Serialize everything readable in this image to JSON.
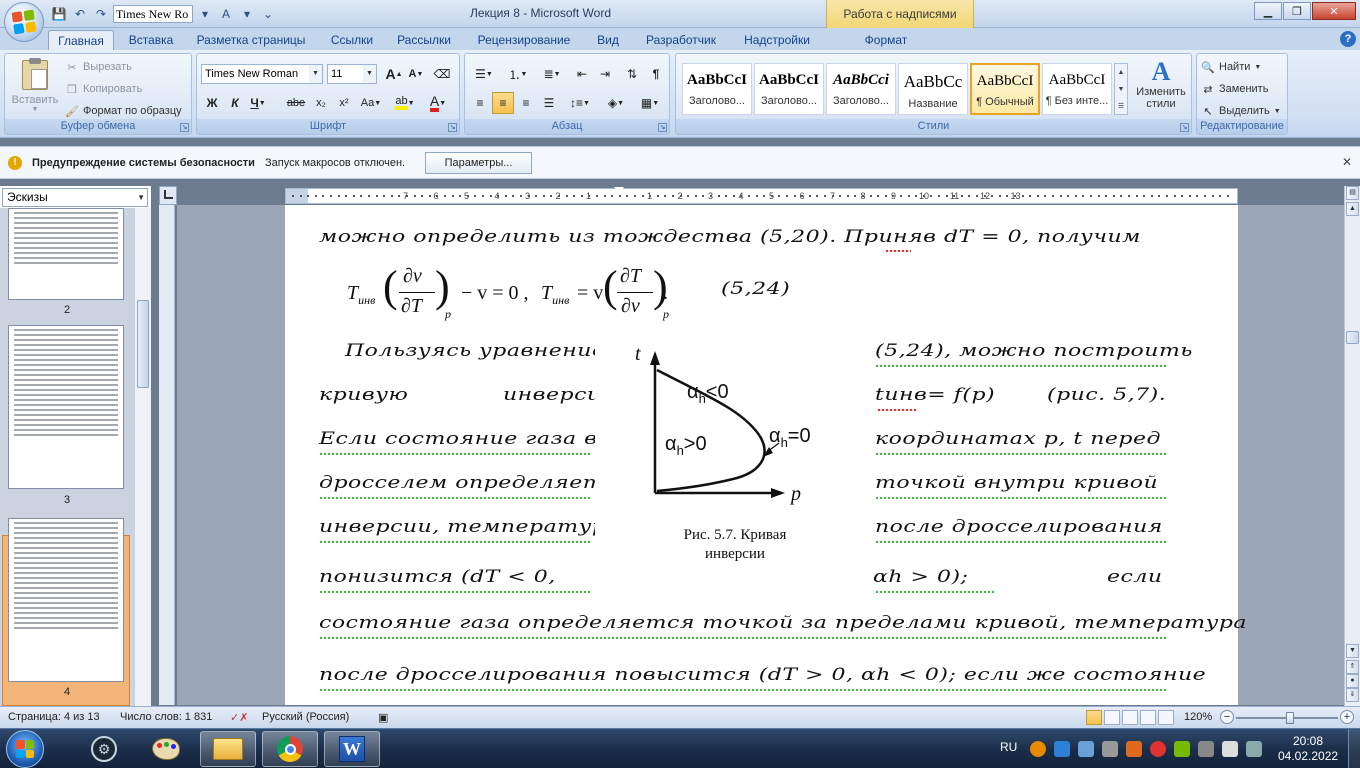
{
  "app": {
    "window_title": "Лекция 8 - Microsoft Word",
    "context_tab_title": "Работа с надписями",
    "qat_font": "Times New Ro",
    "help": "?"
  },
  "tabs": [
    "Главная",
    "Вставка",
    "Разметка страницы",
    "Ссылки",
    "Рассылки",
    "Рецензирование",
    "Вид",
    "Разработчик",
    "Надстройки",
    "Формат"
  ],
  "ribbon": {
    "clipboard": {
      "label": "Буфер обмена",
      "paste": "Вставить",
      "cut": "Вырезать",
      "copy": "Копировать",
      "format_painter": "Формат по образцу"
    },
    "font": {
      "label": "Шрифт",
      "font_name": "Times New Roman",
      "font_size": "11",
      "bold": "Ж",
      "italic": "К",
      "underline": "Ч",
      "strike": "abe",
      "subscript": "x₂",
      "superscript": "x²",
      "change_case": "Aa",
      "grow": "A",
      "shrink": "A"
    },
    "paragraph": {
      "label": "Абзац"
    },
    "styles": {
      "label": "Стили",
      "items": [
        {
          "sample": "AaBbCcI",
          "name": "Заголово..."
        },
        {
          "sample": "AaBbCcI",
          "name": "Заголово..."
        },
        {
          "sample": "AaBbCci",
          "name": "Заголово..."
        },
        {
          "sample": "AaBbCc",
          "name": "Название"
        },
        {
          "sample": "AaBbCcI",
          "name": "¶ Обычный"
        },
        {
          "sample": "AaBbCcI",
          "name": "¶ Без инте..."
        }
      ],
      "change_styles": "Изменить стили"
    },
    "editing": {
      "label": "Редактирование",
      "find": "Найти",
      "replace": "Заменить",
      "select": "Выделить"
    }
  },
  "security": {
    "title": "Предупреждение системы безопасности",
    "message": "Запуск макросов отключен.",
    "button": "Параметры..."
  },
  "left_pane": {
    "view": "Эскизы",
    "pages": [
      "2",
      "3",
      "4"
    ]
  },
  "ruler": {
    "left_numbers": [
      "7",
      "6",
      "5",
      "4",
      "3",
      "2",
      "1"
    ],
    "right_numbers": [
      "1",
      "2",
      "3",
      "4",
      "5",
      "6",
      "7",
      "8",
      "9",
      "10",
      "11",
      "12",
      "13"
    ]
  },
  "document": {
    "lines": [
      "можно определить из тождества (5,20). Приняв dT = 0, получим",
      "(5,24)",
      "Пользуясь уравнением",
      "(5,24), можно построить",
      "кривую",
      "инверсии",
      "tинв= f(p)",
      "(рис. 5,7).",
      "Если состояние газа в",
      "координатах p, t перед",
      "дросселем определяется",
      "точкой внутри кривой",
      "инверсии, температура",
      "после дросселирования",
      "понизится (dT < 0,",
      "αh > 0);",
      "если",
      "состояние газа определяется точкой за пределами кривой, температура",
      "после дросселирования повысится (dT > 0, αh < 0); если же состояние"
    ],
    "formula": {
      "t_inv": "T",
      "inv_sub": "инв",
      "dv": "∂v",
      "dT": "∂T",
      "sub_p": "p",
      "minus_v": "− v = 0 ,",
      "eq_v": "= v",
      "dot": "."
    },
    "figure": {
      "axis_t": "t",
      "axis_p": "p",
      "label_top": "α",
      "label_top_sub": "h",
      "label_top_rel": "<0",
      "label_inner": "α",
      "label_inner_sub": "h",
      "label_inner_rel": ">0",
      "label_curve": "α",
      "label_curve_sub": "h",
      "label_curve_rel": "=0",
      "caption_line1": "Рис. 5.7.  Кривая",
      "caption_line2": "инверсии"
    }
  },
  "status": {
    "page": "Страница: 4 из 13",
    "words": "Число слов: 1 831",
    "language": "Русский (Россия)",
    "zoom": "120%"
  },
  "taskbar": {
    "lang": "RU",
    "time": "20:08",
    "date": "04.02.2022"
  }
}
